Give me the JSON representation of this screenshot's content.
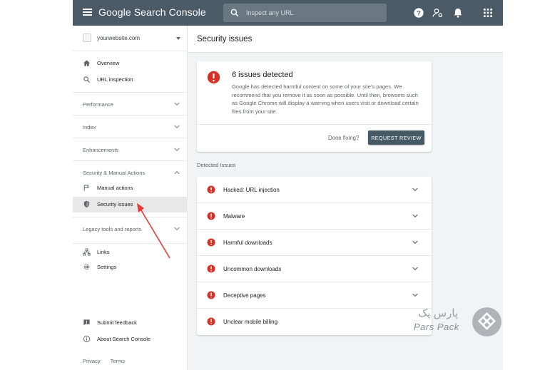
{
  "topbar": {
    "brand": "Google Search Console",
    "search_placeholder": "Inspect any URL"
  },
  "sidebar": {
    "property": "yourwebsite.com",
    "items_top": [
      {
        "label": "Overview",
        "icon": "home-icon"
      },
      {
        "label": "URL inspection",
        "icon": "search-icon"
      }
    ],
    "sections": [
      "Performance",
      "Index",
      "Enhancements",
      "Security & Manual Actions"
    ],
    "security_items": [
      {
        "label": "Manual actions",
        "icon": "flag-icon"
      },
      {
        "label": "Security issues",
        "icon": "shield-icon"
      }
    ],
    "legacy": "Legacy tools and reports",
    "items_bottom": [
      {
        "label": "Links",
        "icon": "links-icon"
      },
      {
        "label": "Settings",
        "icon": "gear-icon"
      }
    ],
    "support": [
      {
        "label": "Submit feedback",
        "icon": "feedback-icon"
      },
      {
        "label": "About Search Console",
        "icon": "info-icon"
      }
    ],
    "footer": {
      "privacy": "Privacy",
      "terms": "Terms"
    }
  },
  "main": {
    "title": "Security issues",
    "card": {
      "title": "6 issues detected",
      "body": "Google has detected harmful content on some of your site's pages. We recommend that you remove it as soon as possible. Until then, browsers such as Google Chrome will display a warning when users visit or download certain files from your site.",
      "done_label": "Done fixing?",
      "button": "REQUEST REVIEW"
    },
    "detected_label": "Detected Issues",
    "issues": [
      "Hacked: URL injection",
      "Malware",
      "Harmful downloads",
      "Uncommon downloads",
      "Deceptive pages",
      "Unclear mobile billing"
    ]
  },
  "watermark": {
    "latin": "Pars Pack",
    "farsi": "پارس پک"
  },
  "colors": {
    "topbar": "#4a5a66",
    "alert": "#d93025",
    "button": "#455a64"
  }
}
